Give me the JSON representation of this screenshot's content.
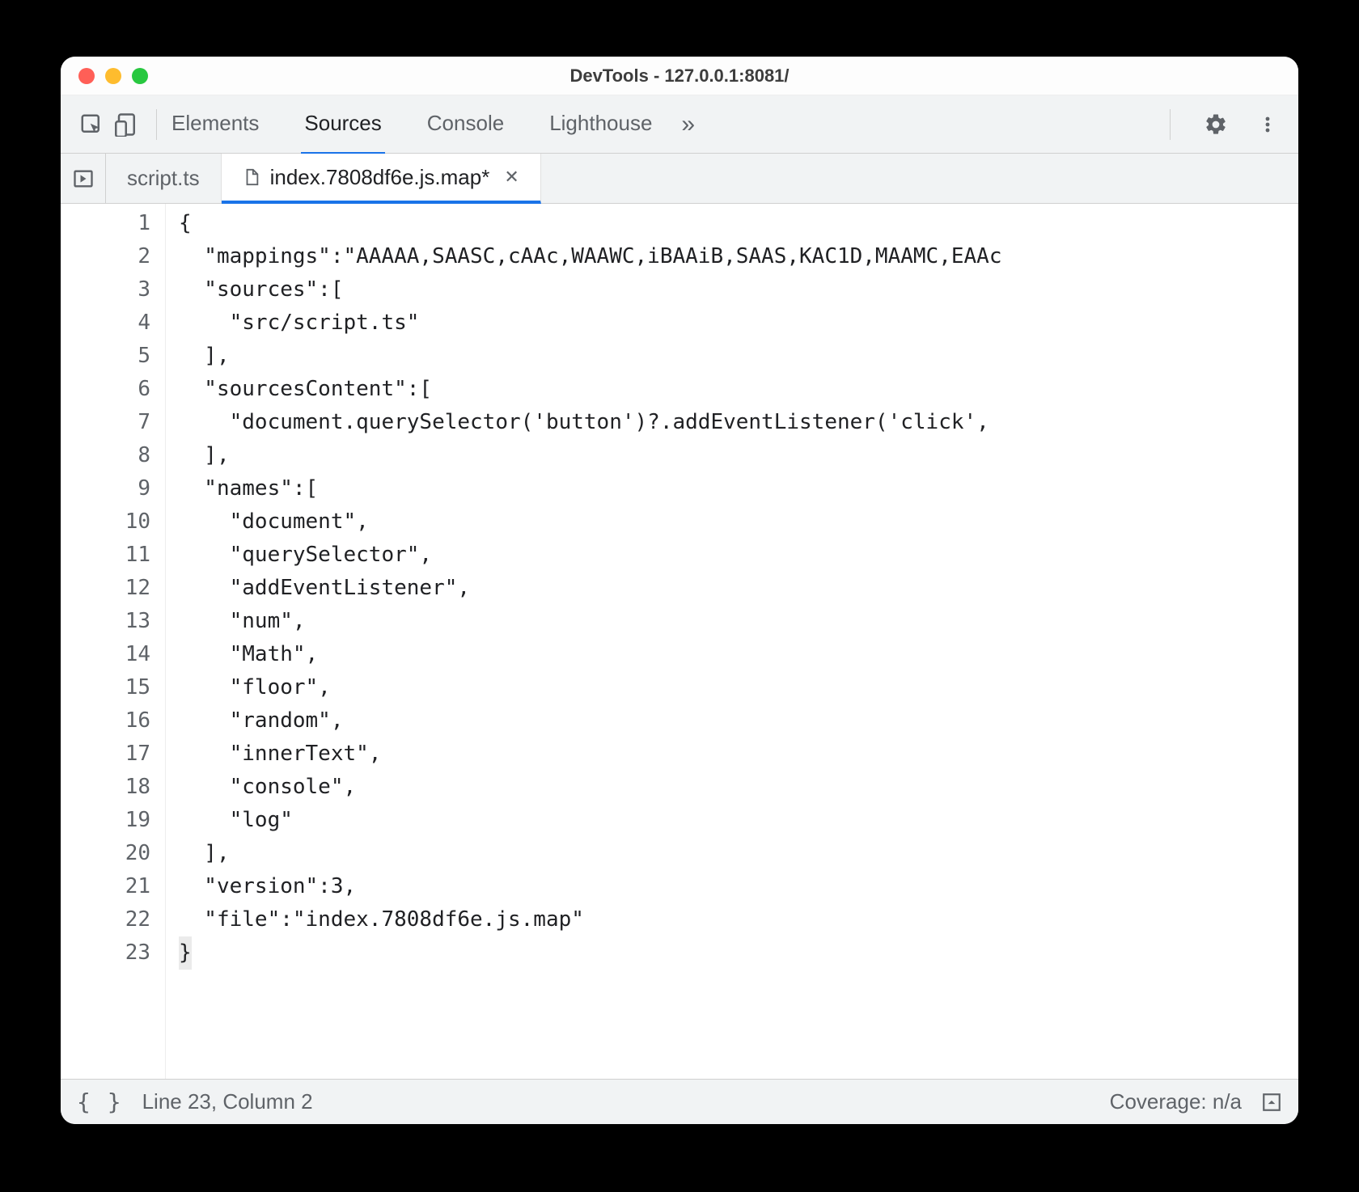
{
  "window": {
    "title": "DevTools - 127.0.0.1:8081/"
  },
  "panels": {
    "tabs": [
      "Elements",
      "Sources",
      "Console",
      "Lighthouse"
    ],
    "active": "Sources",
    "more_glyph": "»"
  },
  "file_tabs": [
    {
      "label": "script.ts",
      "active": false,
      "modified": false,
      "icon": null
    },
    {
      "label": "index.7808df6e.js.map*",
      "active": true,
      "modified": true,
      "icon": "file"
    }
  ],
  "editor": {
    "lines": [
      "{",
      "  \"mappings\":\"AAAAA,SAASC,cAAc,WAAWC,iBAAiB,SAAS,KAC1D,MAAMC,EAAc",
      "  \"sources\":[",
      "    \"src/script.ts\"",
      "  ],",
      "  \"sourcesContent\":[",
      "    \"document.querySelector('button')?.addEventListener('click',",
      "  ],",
      "  \"names\":[",
      "    \"document\",",
      "    \"querySelector\",",
      "    \"addEventListener\",",
      "    \"num\",",
      "    \"Math\",",
      "    \"floor\",",
      "    \"random\",",
      "    \"innerText\",",
      "    \"console\",",
      "    \"log\"",
      "  ],",
      "  \"version\":3,",
      "  \"file\":\"index.7808df6e.js.map\"",
      "}"
    ],
    "cursor_line": 23
  },
  "statusbar": {
    "position": "Line 23, Column 2",
    "coverage": "Coverage: n/a"
  }
}
